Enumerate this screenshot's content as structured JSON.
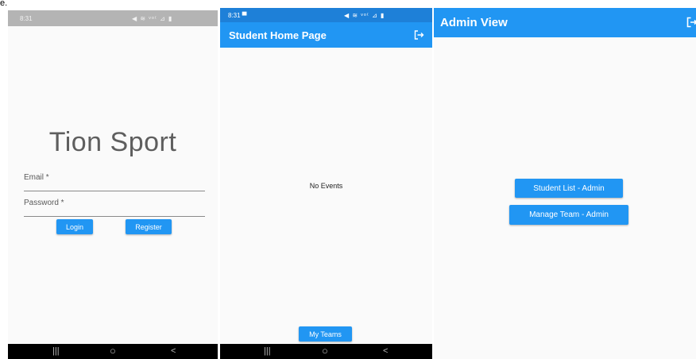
{
  "stray_text": "e.",
  "login_screen": {
    "status_time": "8:31",
    "status_icons": "◀ ≋ ᵛᵒ⁽ ⊿ ▮",
    "title": "Tion Sport",
    "email_label": "Email *",
    "password_label": "Password *",
    "login_label": "Login",
    "register_label": "Register",
    "nav_icons": [
      "|||",
      "○",
      "<"
    ]
  },
  "student_screen": {
    "status_time": "8:31 ▀",
    "status_icons": "◀ ≋ ᵛᵒ⁽ ⊿ ▮",
    "title": "Student Home Page",
    "logout_icon": "logout-icon",
    "empty_text": "No Events",
    "my_teams_label": "My Teams",
    "nav_icons": [
      "|||",
      "○",
      "<"
    ]
  },
  "admin_screen": {
    "title": "Admin View",
    "logout_icon": "logout-icon",
    "student_list_label": "Student List - Admin",
    "manage_team_label": "Manage Team - Admin"
  },
  "colors": {
    "primary": "#2196f3",
    "status_bar_blue": "#1e80d8",
    "status_bar_gray": "#b4b4b4",
    "background": "#fafafa",
    "nav_bar": "#000000"
  }
}
